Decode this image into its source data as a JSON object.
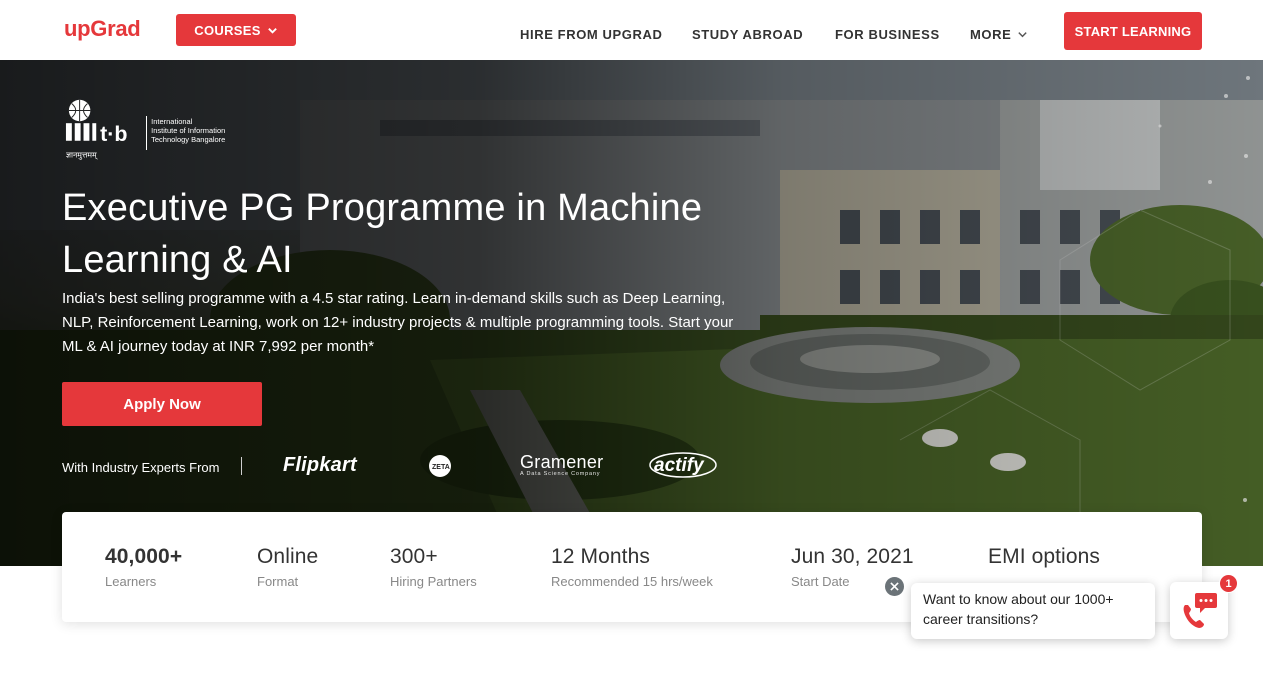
{
  "header": {
    "logo": "upGrad",
    "courses_label": "COURSES",
    "nav": {
      "hire": "HIRE FROM UPGRAD",
      "study": "STUDY ABROAD",
      "business": "FOR BUSINESS",
      "more": "MORE"
    },
    "cta": "START LEARNING"
  },
  "hero": {
    "institute": {
      "short": "iiit·b",
      "name_line1": "International",
      "name_line2": "Institute of Information",
      "name_line3": "Technology Bangalore",
      "motto": "ज्ञानमुत्तमम्"
    },
    "title": "Executive PG Programme in Machine Learning & AI",
    "description": "India's best selling programme with a 4.5 star rating. Learn in-demand skills such as Deep Learning, NLP, Reinforcement Learning, work on 12+ industry projects & multiple programming tools. Start your ML & AI journey today at INR 7,992 per month*",
    "apply_label": "Apply Now",
    "experts_label": "With Industry Experts From",
    "partners": {
      "flipkart": "Flipkart",
      "zeta": "ZETA",
      "gramener": "Gramener",
      "gramener_sub": "A Data Science Company",
      "actify": "actify"
    }
  },
  "stats": [
    {
      "value": "40,000+",
      "label": "Learners"
    },
    {
      "value": "Online",
      "label": "Format"
    },
    {
      "value": "300+",
      "label": "Hiring Partners"
    },
    {
      "value": "12 Months",
      "label": "Recommended 15 hrs/week"
    },
    {
      "value": "Jun 30, 2021",
      "label": "Start Date"
    },
    {
      "value": "EMI options",
      "label": ""
    }
  ],
  "chat": {
    "message": "Want to know about our 1000+ career transitions?",
    "badge": "1"
  },
  "colors": {
    "brand_red": "#e5383b",
    "text_dark": "#333333",
    "text_muted": "#888888"
  }
}
